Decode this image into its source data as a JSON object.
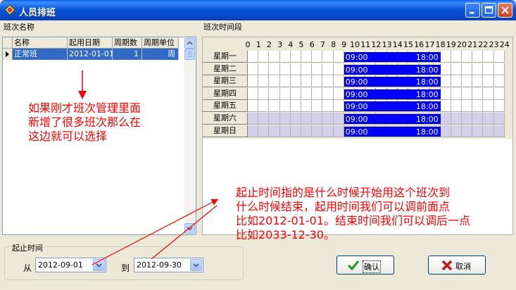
{
  "window": {
    "title": "人员排班"
  },
  "left_panel": {
    "label": "班次名称",
    "columns": [
      "名称",
      "起用日期",
      "周期数",
      "周期单位"
    ],
    "rows": [
      {
        "name": "正常班",
        "start_date": "2012-01-01",
        "cycles": "1",
        "unit": "周"
      }
    ]
  },
  "right_panel": {
    "label": "班次时间段",
    "hours": [
      "0",
      "1",
      "2",
      "3",
      "4",
      "5",
      "6",
      "7",
      "8",
      "9",
      "10",
      "11",
      "12",
      "13",
      "14",
      "15",
      "16",
      "17",
      "18",
      "19",
      "20",
      "21",
      "22",
      "23",
      "24"
    ],
    "days": [
      {
        "label": "星期一",
        "start": "09:00",
        "end": "18:00",
        "weekend": false
      },
      {
        "label": "星期二",
        "start": "09:00",
        "end": "18:00",
        "weekend": false
      },
      {
        "label": "星期三",
        "start": "09:00",
        "end": "18:00",
        "weekend": false
      },
      {
        "label": "星期四",
        "start": "09:00",
        "end": "18:00",
        "weekend": false
      },
      {
        "label": "星期五",
        "start": "09:00",
        "end": "18:00",
        "weekend": false
      },
      {
        "label": "星期六",
        "start": "09:00",
        "end": "18:00",
        "weekend": true
      },
      {
        "label": "星期日",
        "start": "09:00",
        "end": "18:00",
        "weekend": true
      }
    ]
  },
  "date_range": {
    "label": "起止时间",
    "from_label": "从",
    "from_value": "2012-09-01",
    "to_label": "到",
    "to_value": "2012-09-30"
  },
  "buttons": {
    "ok": "确认",
    "cancel": "取消"
  },
  "annotations": {
    "left": [
      "如果刚才班次管理里面",
      "新增了很多班次那么在",
      "这边就可以选择"
    ],
    "right": [
      "起止时间指的是什么时候开始用这个班次到",
      "什么时候结束，起用时间我们可以调前面点",
      "比如2012-01-01。结束时间我们可以调后一点",
      "比如2033-12-30。"
    ]
  },
  "colors": {
    "accent_bar": "#0000ff",
    "selection": "#316ac5",
    "annotation": "#ff0000",
    "weekend_row": "#d4d0e8"
  }
}
